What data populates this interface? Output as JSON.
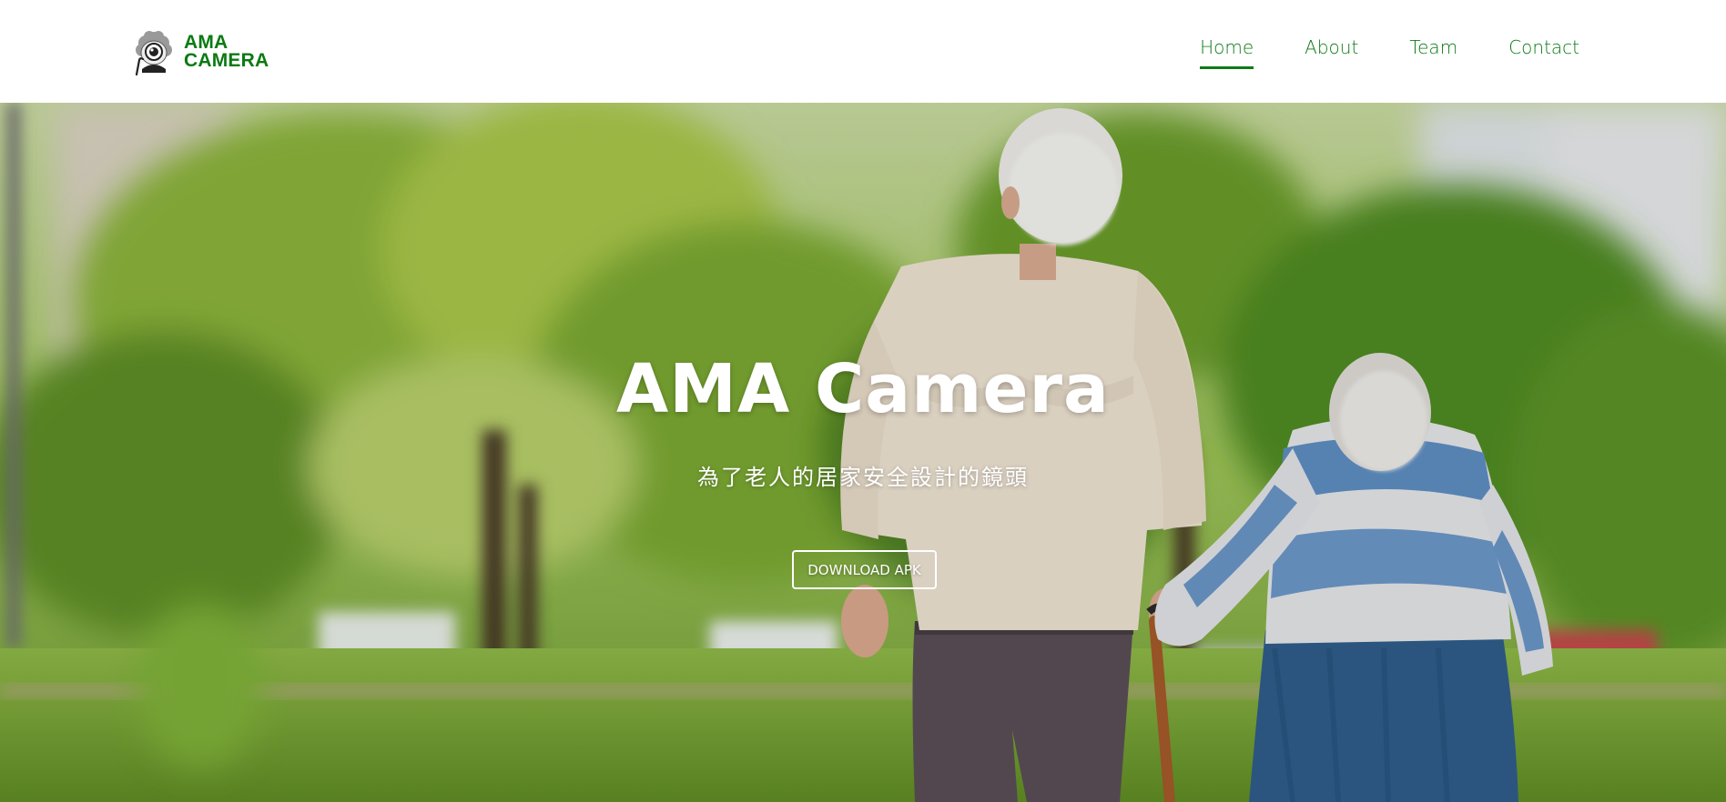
{
  "brand": {
    "logo_icon": "camera-eye-mascot-icon",
    "line1": "AMA",
    "line2": "CAMERA",
    "color": "#0a7a12"
  },
  "nav": {
    "items": [
      {
        "label": "Home",
        "active": true
      },
      {
        "label": "About",
        "active": false
      },
      {
        "label": "Team",
        "active": false
      },
      {
        "label": "Contact",
        "active": false
      }
    ],
    "color": "#0e7a16"
  },
  "hero": {
    "title": "AMA Camera",
    "subtitle": "為了老人的居家安全設計的鏡頭",
    "button_label": "DOWNLOAD APK"
  }
}
